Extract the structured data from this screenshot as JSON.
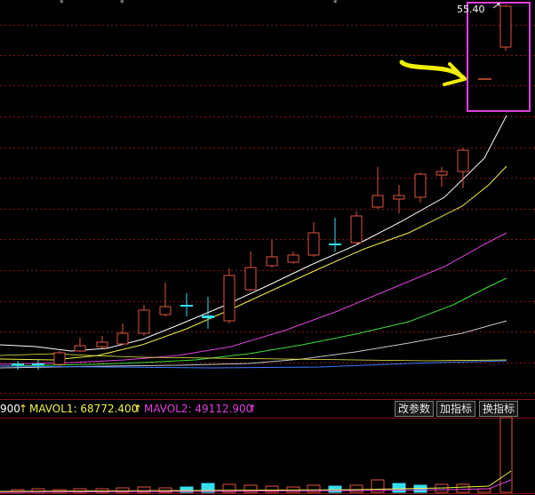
{
  "colors": {
    "background": "#000000",
    "grid": "#8a1414",
    "up": "#e0553f",
    "down": "#33e0f0",
    "ma_white": "#ffffff",
    "ma_yellow": "#f0f046",
    "ma_magenta": "#e040e0",
    "ma_green": "#3ce03c",
    "ma_gray": "#c8c8c8",
    "ma_blue": "#3c78ff",
    "annotation": "#f0f000",
    "highlight_box": "#e040e0"
  },
  "chart": {
    "price_label": "55.40"
  },
  "volume_indicator": {
    "prefix": "900",
    "mavol1_label": "MAVOL1: 68772.400",
    "mavol1_color": "#f0f046",
    "mavol2_label": "MAVOL2: 49112.900",
    "mavol2_color": "#e040e0",
    "arrow": "↑"
  },
  "buttons": {
    "params": "改参数",
    "add": "加指标",
    "swap": "换指标"
  },
  "icons": [
    "up-arrow-icon",
    "highlight-box",
    "annotation-arrow"
  ]
}
